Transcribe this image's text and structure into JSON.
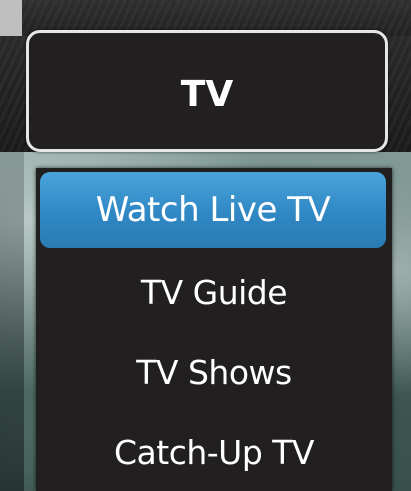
{
  "top_menu": {
    "button_label": "TV"
  },
  "dropdown": {
    "items": [
      {
        "label": "Watch Live TV",
        "selected": true
      },
      {
        "label": "TV Guide",
        "selected": false
      },
      {
        "label": "TV Shows",
        "selected": false
      },
      {
        "label": "Catch-Up TV",
        "selected": false
      }
    ]
  },
  "colors": {
    "selected_item": "#3a94cf",
    "menu_background": "#221f20",
    "button_border": "#e6e6e6",
    "text": "#ffffff"
  }
}
